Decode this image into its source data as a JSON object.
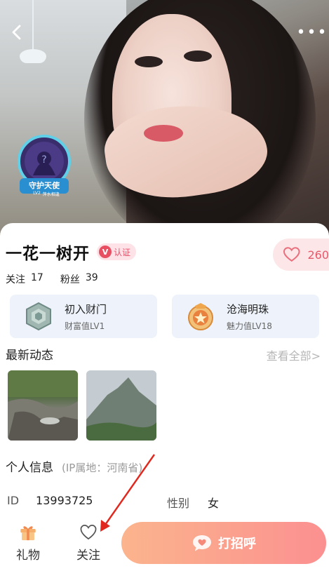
{
  "header": {
    "back_icon": "chevron-left-icon",
    "more_icon": "more-dots-icon",
    "more_label": "•••"
  },
  "guardian_badge": {
    "title": "守护天使",
    "level": "LV2",
    "subtitle": "萍水相逢"
  },
  "profile": {
    "name": "一花一树开",
    "verify_mark": "V",
    "verify_label": "认证",
    "like_count": "260",
    "following_label": "关注",
    "following_count": "17",
    "fans_label": "粉丝",
    "fans_count": "39"
  },
  "honors": [
    {
      "title": "初入财门",
      "sub": "财富值LV1"
    },
    {
      "title": "沧海明珠",
      "sub": "魅力值LV18"
    }
  ],
  "moments": {
    "title": "最新动态",
    "see_all": "查看全部>"
  },
  "info": {
    "title": "个人信息",
    "ip": "(IP属地：河南省)",
    "id_label": "ID",
    "id_value": "13993725",
    "gender_label": "性别",
    "gender_value": "女"
  },
  "bottom_bar": {
    "gift_label": "礼物",
    "follow_label": "关注",
    "greet_label": "打招呼"
  },
  "colors": {
    "accent_pink": "#e55a6b",
    "greet_gradient_start": "#fbb48d",
    "greet_gradient_end": "#fb9090",
    "annotation_arrow": "#e0281e"
  }
}
